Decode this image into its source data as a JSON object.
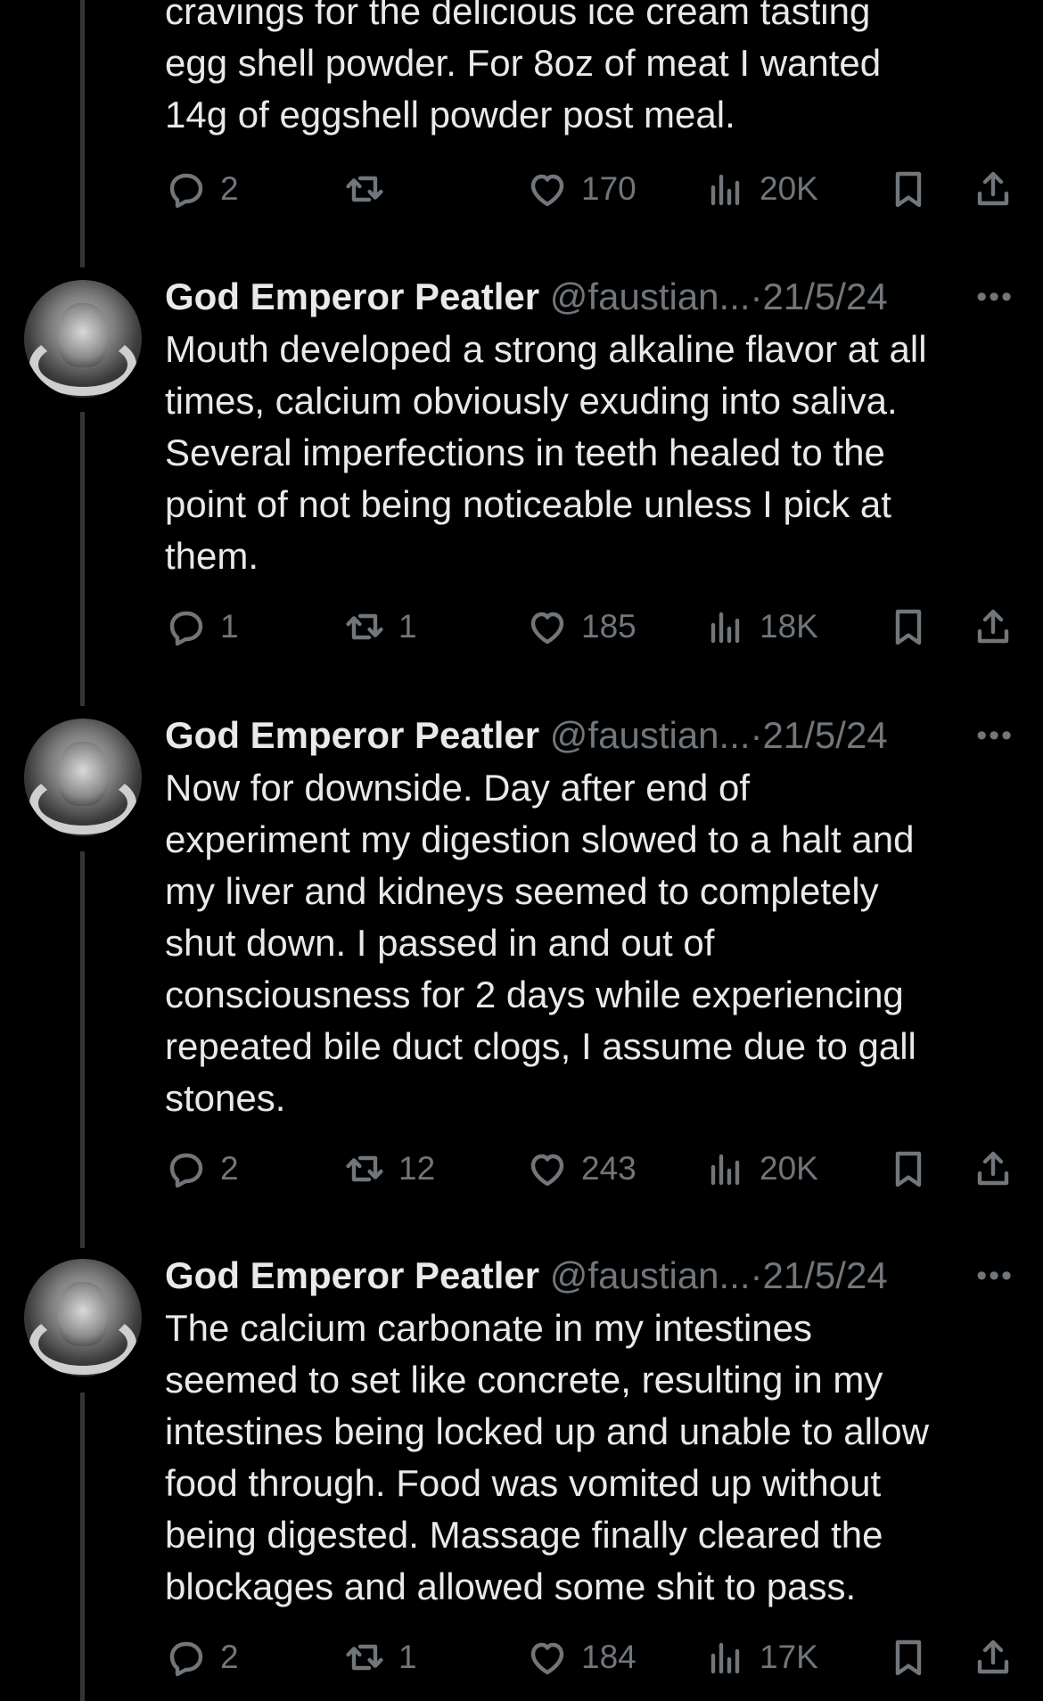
{
  "top_tweet": {
    "text": "cravings for the delicious ice cream tasting\negg shell powder. For 8oz of meat I wanted\n14g of eggshell powder post meal.",
    "replies": "2",
    "reposts": "",
    "likes": "170",
    "views": "20K"
  },
  "tweets": [
    {
      "name": "God Emperor Peatler",
      "handle": "@faustian...",
      "date": "21/5/24",
      "text": "Mouth developed a strong alkaline flavor at all\ntimes, calcium obviously exuding into saliva.\nSeveral imperfections in teeth healed to the\npoint of not being noticeable unless I pick at\nthem.",
      "replies": "1",
      "reposts": "1",
      "likes": "185",
      "views": "18K"
    },
    {
      "name": "God Emperor Peatler",
      "handle": "@faustian...",
      "date": "21/5/24",
      "text": "Now for downside. Day after end of\nexperiment my digestion slowed to a halt and\nmy liver and kidneys seemed to completely\nshut down. I passed in and out of\nconsciousness for 2 days while experiencing\nrepeated bile duct clogs, I assume due to gall\nstones.",
      "replies": "2",
      "reposts": "12",
      "likes": "243",
      "views": "20K"
    },
    {
      "name": "God Emperor Peatler",
      "handle": "@faustian...",
      "date": "21/5/24",
      "text": "The calcium carbonate in my intestines\nseemed to set like concrete, resulting in my\nintestines being locked up and unable to allow\nfood through. Food was vomited up without\nbeing digested. Massage finally cleared the\nblockages and allowed some shit to pass.",
      "replies": "2",
      "reposts": "1",
      "likes": "184",
      "views": "17K"
    }
  ],
  "separator": "·",
  "more_glyph": "•••",
  "icons": [
    "reply-icon",
    "repost-icon",
    "like-icon",
    "views-icon",
    "bookmark-icon",
    "share-icon",
    "more-icon"
  ]
}
